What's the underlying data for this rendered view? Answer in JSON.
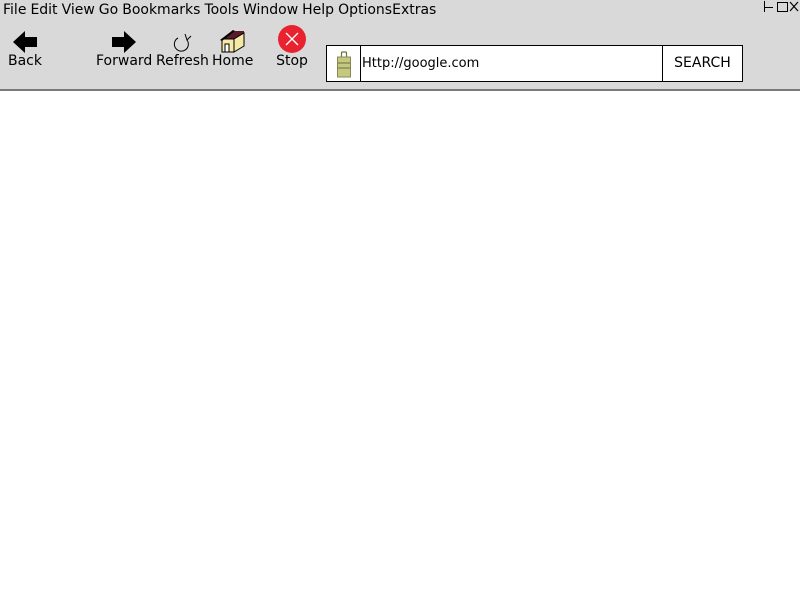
{
  "menubar": {
    "items": [
      "File",
      "Edit",
      "View",
      "Go",
      "Bookmarks",
      "Tools",
      "Window",
      "Help",
      "Options",
      "Extras"
    ]
  },
  "toolbar": {
    "back_label": "Back",
    "forward_label": "Forward",
    "refresh_label": "Refresh",
    "home_label": "Home",
    "stop_label": "Stop"
  },
  "address_bar": {
    "url": "Http://google.com",
    "search_label": "SEARCH"
  },
  "colors": {
    "chrome_bg": "#d9d9d9",
    "stop_red": "#e8232f",
    "lock_fill": "#c4c97e",
    "home_wall": "#f5e9a8",
    "home_roof": "#5a1a2a"
  },
  "icons": {
    "back": "arrow-left-icon",
    "forward": "arrow-right-icon",
    "refresh": "refresh-icon",
    "home": "house-icon",
    "stop": "stop-icon",
    "lock": "lock-icon"
  }
}
